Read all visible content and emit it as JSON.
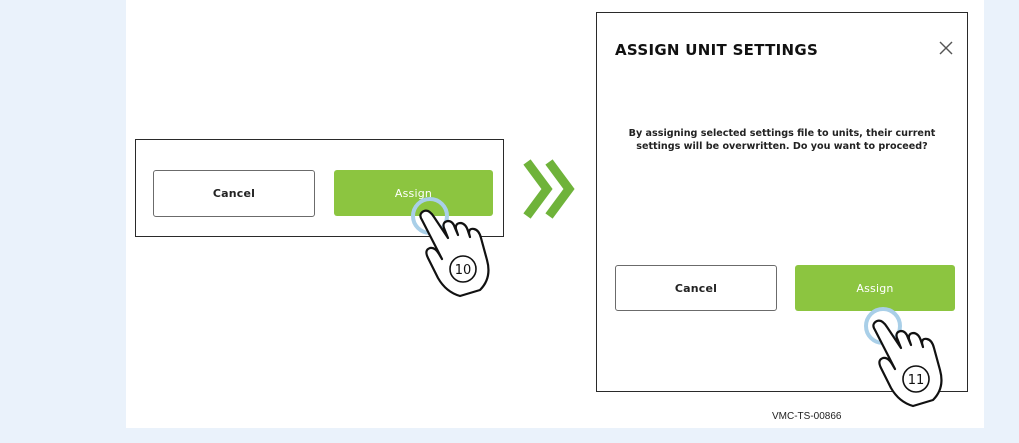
{
  "left_panel": {
    "cancel_label": "Cancel",
    "assign_label": "Assign",
    "step_number": "⑩"
  },
  "arrow": {
    "icon": "double-chevron-right-icon",
    "color": "#6fb33a"
  },
  "dialog": {
    "title": "ASSIGN UNIT SETTINGS",
    "close_icon": "close-icon",
    "message": "By assigning selected settings file to units, their current settings will be overwritten. Do you want to proceed?",
    "cancel_label": "Cancel",
    "assign_label": "Assign",
    "step_number": "⑪"
  },
  "colors": {
    "assign_button": "#8cc540",
    "background": "#eaf2fb",
    "touch_ring": "#a9cfe8"
  },
  "reference_code": "VMC-TS-00866"
}
